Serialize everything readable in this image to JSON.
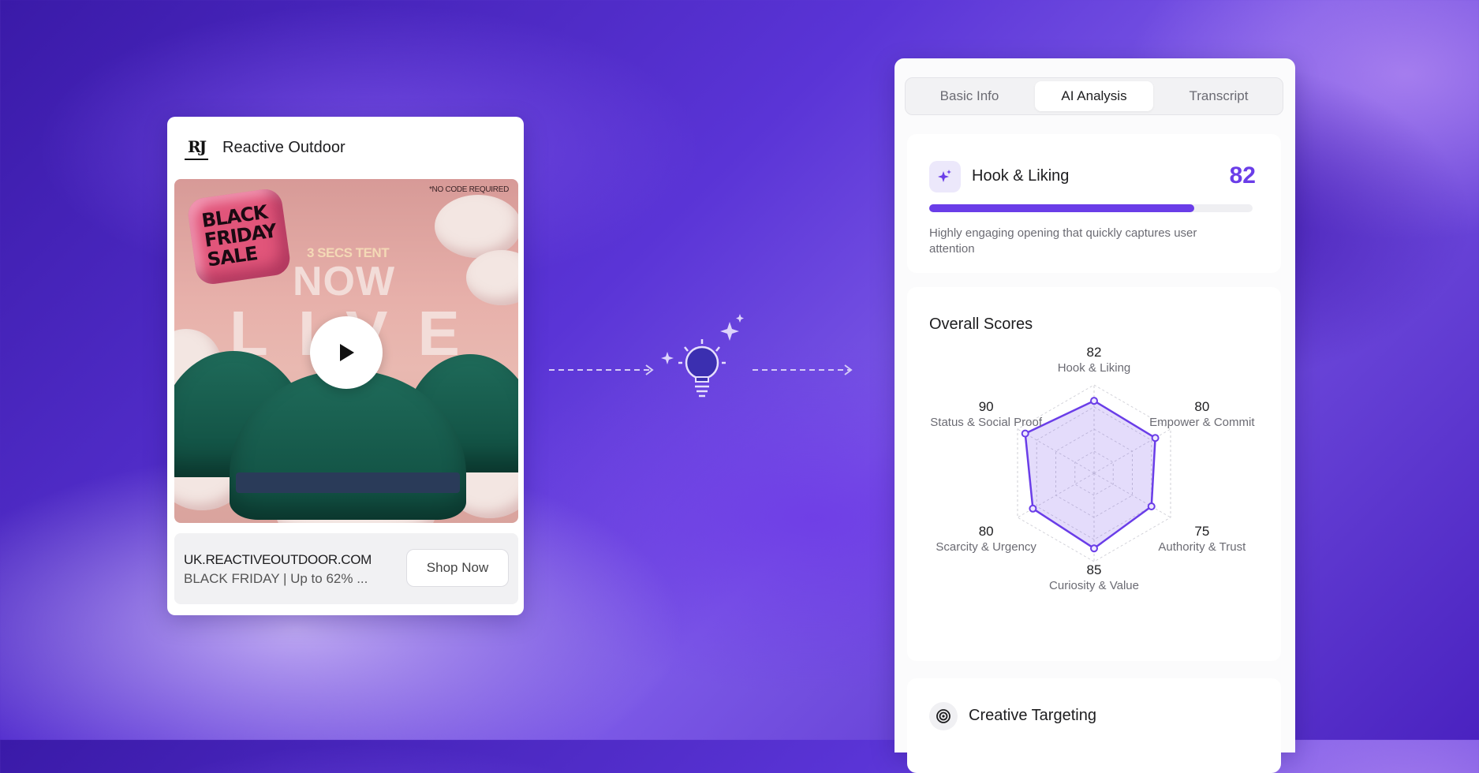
{
  "ad": {
    "brand_name": "Reactive Outdoor",
    "brand_logo_text": "RJ",
    "media": {
      "balloon_text": "BLACK FRIDAY SALE",
      "small_print": "*NO CODE REQUIRED",
      "secs_text": "3 SECS TENT",
      "now_text": "NOW",
      "live_text": "LIVE"
    },
    "url": "UK.REACTIVEOUTDOOR.COM",
    "description": "BLACK FRIDAY | Up to 62% ...",
    "cta_label": "Shop Now"
  },
  "panel": {
    "tabs": [
      {
        "label": "Basic Info",
        "active": false
      },
      {
        "label": "AI Analysis",
        "active": true
      },
      {
        "label": "Transcript",
        "active": false
      }
    ],
    "hook": {
      "title": "Hook & Liking",
      "score": "82",
      "progress": 0.82,
      "description": "Highly engaging opening that quickly captures user attention"
    },
    "overall": {
      "title": "Overall Scores"
    },
    "targeting": {
      "title": "Creative Targeting"
    }
  },
  "chart_data": {
    "type": "radar",
    "max": 100,
    "axes": [
      {
        "label": "Hook & Liking",
        "value": 82
      },
      {
        "label": "Empower & Commit",
        "value": 80
      },
      {
        "label": "Authority & Trust",
        "value": 75
      },
      {
        "label": "Curiosity & Value",
        "value": 85
      },
      {
        "label": "Scarcity & Urgency",
        "value": 80
      },
      {
        "label": "Status & Social Proof",
        "value": 90
      }
    ],
    "colors": {
      "line": "#6a3de8",
      "fill": "#6a3de8",
      "grid": "#cfcfd6"
    }
  }
}
